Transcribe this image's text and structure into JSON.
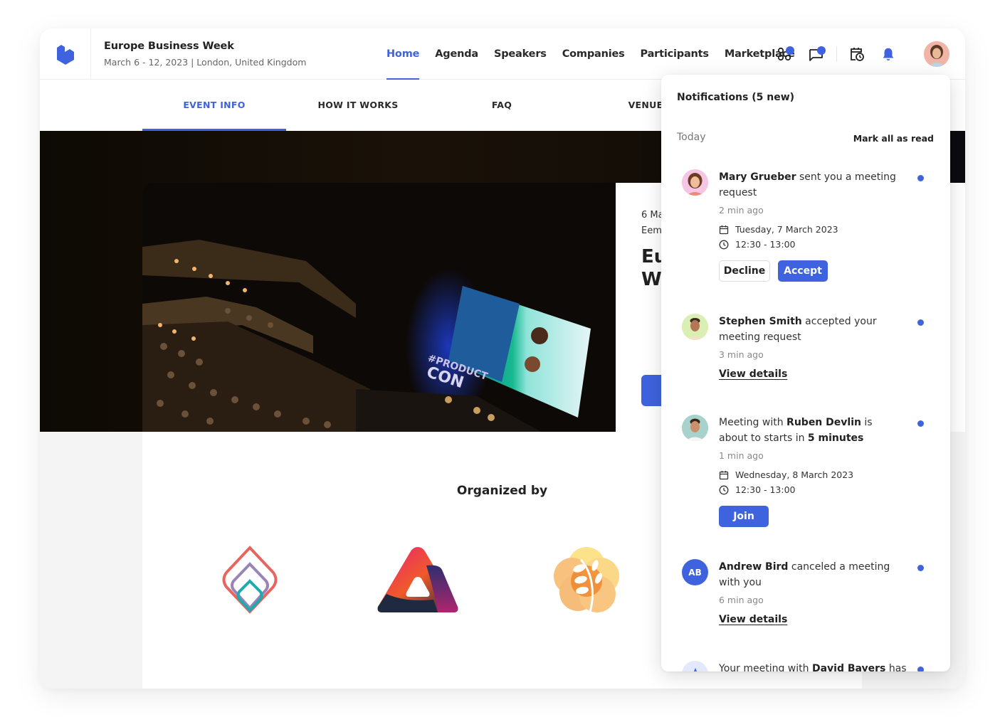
{
  "header": {
    "event_title": "Europe Business Week",
    "event_subtitle": "March 6 - 12, 2023 | London, United Kingdom",
    "brand_color": "#3f63df"
  },
  "main_nav": [
    {
      "label": "Home",
      "active": true
    },
    {
      "label": "Agenda",
      "active": false
    },
    {
      "label": "Speakers",
      "active": false
    },
    {
      "label": "Companies",
      "active": false
    },
    {
      "label": "Participants",
      "active": false
    },
    {
      "label": "Marketplace",
      "active": false
    }
  ],
  "header_icons": [
    "apps-icon",
    "chat-icon",
    "calendar-clock-icon",
    "bell-icon",
    "user-avatar"
  ],
  "sub_tabs": [
    {
      "label": "EVENT INFO",
      "active": true
    },
    {
      "label": "HOW IT WORKS",
      "active": false
    },
    {
      "label": "FAQ",
      "active": false
    },
    {
      "label": "VENUE",
      "active": false
    }
  ],
  "hero": {
    "date_partial": "6 Ma",
    "location_partial": "Eem",
    "title_line1_partial": "Eu",
    "title_line2_partial": "We",
    "screen_text": "#PRODUCT CON"
  },
  "organized": {
    "heading": "Organized by",
    "logos": [
      "layered-diamond-logo",
      "gradient-triangle-logo",
      "orange-tree-logo"
    ]
  },
  "notifications": {
    "title": "Notifications (5 new)",
    "section": "Today",
    "mark_all": "Mark all as read",
    "items": [
      {
        "name": "Mary Grueber",
        "text": " sent you a meeting request",
        "ago": "2 min ago",
        "date": "Tuesday, 7 March 2023",
        "time": "12:30 - 13:00",
        "decline": "Decline",
        "accept": "Accept",
        "unread": true
      },
      {
        "name": "Stephen Smith",
        "text": " accepted your meeting request",
        "ago": "3 min ago",
        "link": "View details",
        "unread": true
      },
      {
        "pre": "Meeting with ",
        "name": "Ruben Devlin",
        "mid": " is about to starts in ",
        "emph": "5 minutes",
        "ago": "1 min ago",
        "date": "Wednesday, 8 March 2023",
        "time": "12:30 - 13:00",
        "join": "Join",
        "unread": true
      },
      {
        "initials": "AB",
        "name": "Andrew Bird",
        "text": " canceled a meeting with you",
        "ago": "6 min ago",
        "link": "View details",
        "unread": true
      },
      {
        "pre": "Your meeting with ",
        "name": "David Bayers",
        "text": " has",
        "unread": true
      }
    ]
  }
}
